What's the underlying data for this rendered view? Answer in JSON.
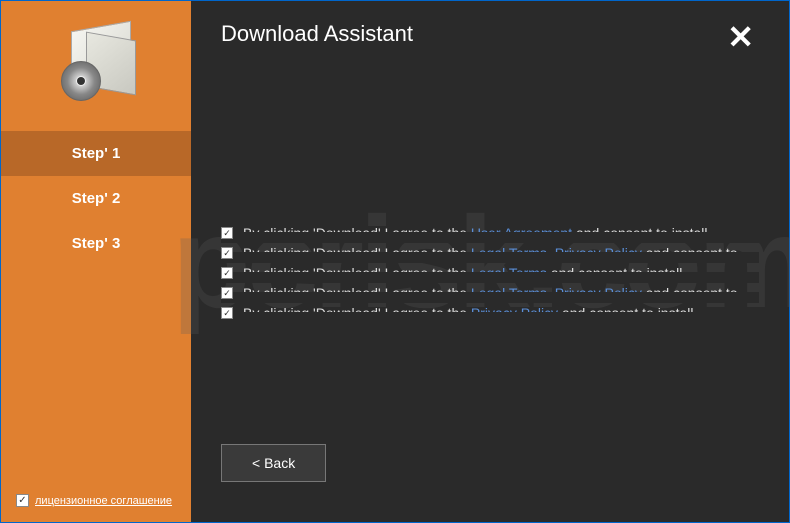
{
  "header": {
    "title": "Download Assistant"
  },
  "sidebar": {
    "steps": [
      {
        "label": "Step' 1",
        "active": true
      },
      {
        "label": "Step' 2",
        "active": false
      },
      {
        "label": "Step' 3",
        "active": false
      }
    ],
    "license": {
      "checked": true,
      "label": "лицензионное соглашение"
    }
  },
  "agreements": {
    "prefix": "By clicking 'Download' I agree to the",
    "suffix_install": "and consent to install",
    "suffix_to": "and consent to",
    "items": [
      {
        "links": [
          "User Agreement"
        ],
        "suffix": "and consent to install"
      },
      {
        "links": [
          "Legal Terms",
          "Privacy Policy"
        ],
        "suffix": "and consent to"
      },
      {
        "links": [
          "Legal Terms"
        ],
        "suffix": "and consent to install"
      },
      {
        "links": [
          "Legal Terms",
          "Privacy Policy"
        ],
        "suffix": "and consent to"
      },
      {
        "links": [
          "Privacy Policy"
        ],
        "suffix": "and consent to install"
      }
    ]
  },
  "buttons": {
    "back": "< Back"
  },
  "watermark": "pcrisk.com"
}
